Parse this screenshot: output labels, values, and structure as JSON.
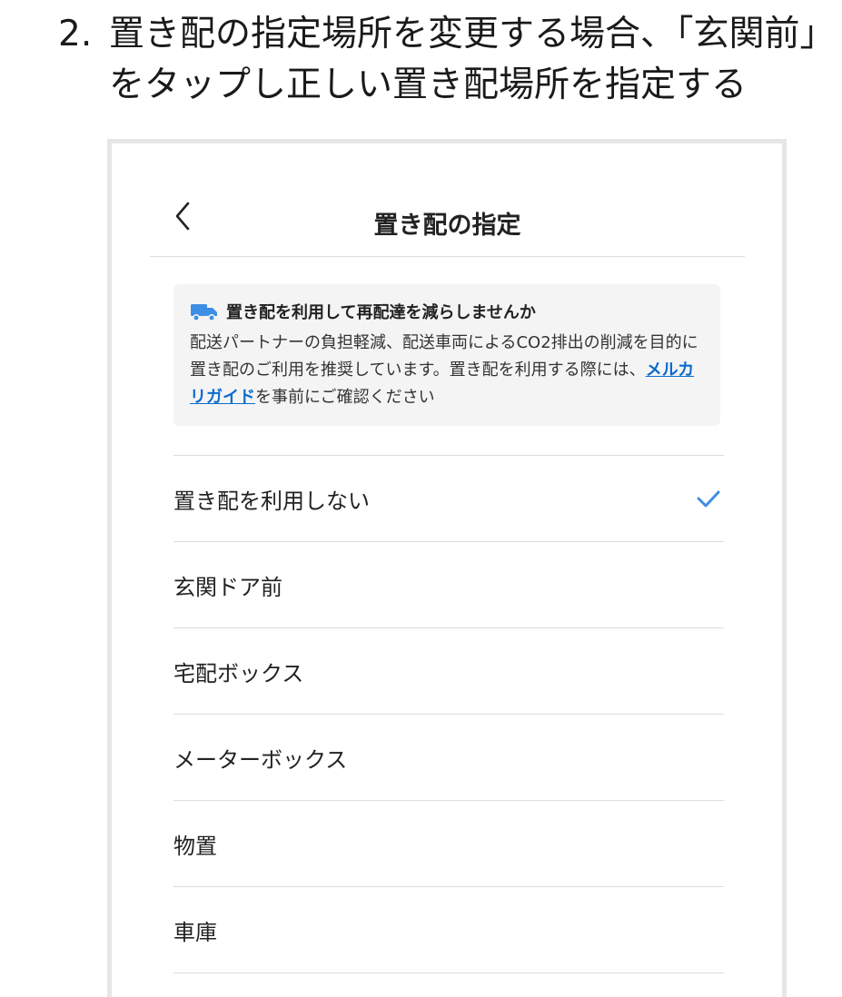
{
  "instruction": {
    "number": "2.",
    "text": "置き配の指定場所を変更する場合、「玄関前」をタップし正しい置き配場所を指定する"
  },
  "screen": {
    "title": "置き配の指定",
    "back_icon": "chevron-left-icon",
    "notice": {
      "icon": "delivery-truck-icon",
      "icon_color": "#3d8ee5",
      "heading": "置き配を利用して再配達を減らしませんか",
      "body_before_link": "配送パートナーの負担軽減、配送車両によるCO2排出の削減を目的に置き配のご利用を推奨しています。置き配を利用する際には、",
      "link_text": "メルカリガイド",
      "body_after_link": "を事前にご確認ください",
      "link_color": "#0b6bcb"
    },
    "options": [
      {
        "label": "置き配を利用しない",
        "selected": true
      },
      {
        "label": "玄関ドア前",
        "selected": false
      },
      {
        "label": "宅配ボックス",
        "selected": false
      },
      {
        "label": "メーターボックス",
        "selected": false
      },
      {
        "label": "物置",
        "selected": false
      },
      {
        "label": "車庫",
        "selected": false
      }
    ],
    "check_icon": "checkmark-icon",
    "accent_color": "#3d8ee5"
  }
}
